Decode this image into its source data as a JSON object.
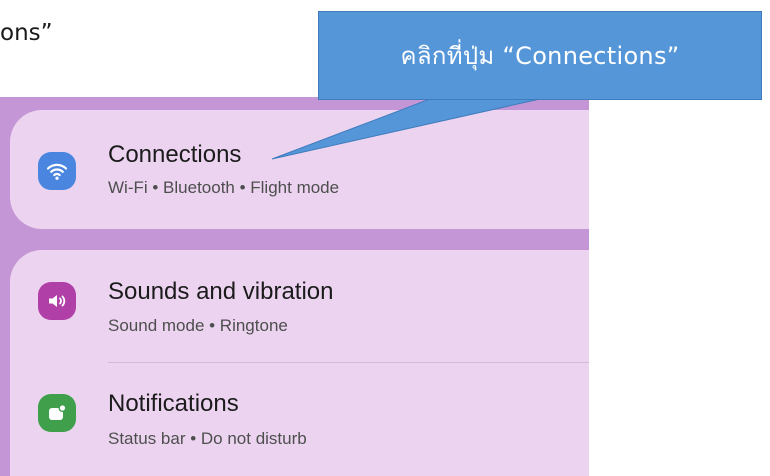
{
  "top_text": "ons”",
  "callout": {
    "text": "คลิกที่ปุ่ม “Connections”"
  },
  "settings": {
    "items": [
      {
        "title": "Connections",
        "subtitle": "Wi-Fi  •  Bluetooth  •  Flight mode",
        "icon": "wifi-icon",
        "icon_color": "#4a86e0"
      },
      {
        "title": "Sounds and vibration",
        "subtitle": "Sound mode  •  Ringtone",
        "icon": "speaker-icon",
        "icon_color": "#b03fa8"
      },
      {
        "title": "Notifications",
        "subtitle": "Status bar  •  Do not disturb",
        "icon": "notification-icon",
        "icon_color": "#3f9f4a"
      }
    ]
  },
  "colors": {
    "background": "#c496d6",
    "card": "#ecd4f1",
    "callout": "#5596d8"
  }
}
